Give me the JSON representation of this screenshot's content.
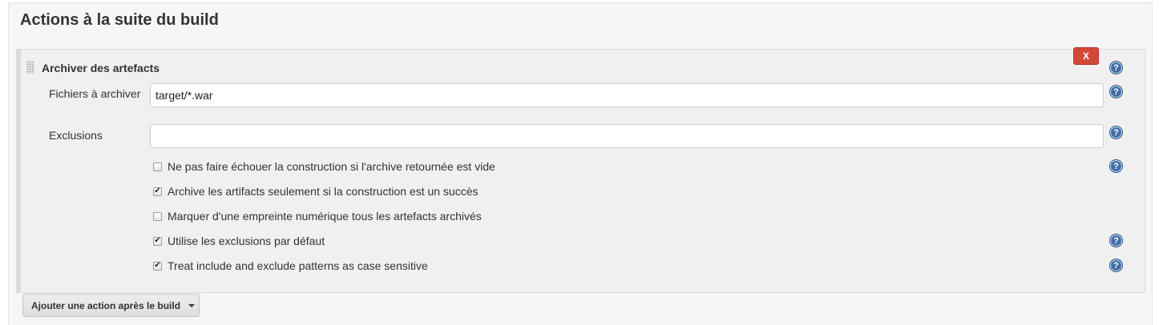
{
  "section": {
    "title": "Actions à la suite du build"
  },
  "step": {
    "title": "Archiver des artefacts",
    "delete_label": "X",
    "help_glyph": "?",
    "fields": {
      "files": {
        "label": "Fichiers à archiver",
        "value": "target/*.war"
      },
      "excludes": {
        "label": "Exclusions",
        "value": ""
      }
    },
    "checkboxes": [
      {
        "label": "Ne pas faire échouer la construction si l'archive retournée est vide",
        "checked": false,
        "help": true
      },
      {
        "label": "Archive les artifacts seulement si la construction est un succès",
        "checked": true,
        "help": false
      },
      {
        "label": "Marquer d'une empreinte numérique tous les artefacts archivés",
        "checked": false,
        "help": false
      },
      {
        "label": "Utilise les exclusions par défaut",
        "checked": true,
        "help": true
      },
      {
        "label": "Treat include and exclude patterns as case sensitive",
        "checked": true,
        "help": true
      }
    ]
  },
  "add_action": {
    "label": "Ajouter une action après le build"
  },
  "colors": {
    "delete_button": "#d24939",
    "help_icon": "#3f6fa8",
    "panel_bg": "#f0f0f0"
  },
  "icons": {
    "help": "help-icon",
    "delete": "close-icon",
    "grip": "drag-handle-icon",
    "dropdown": "chevron-down-icon",
    "checkmark": "checkmark-icon"
  }
}
